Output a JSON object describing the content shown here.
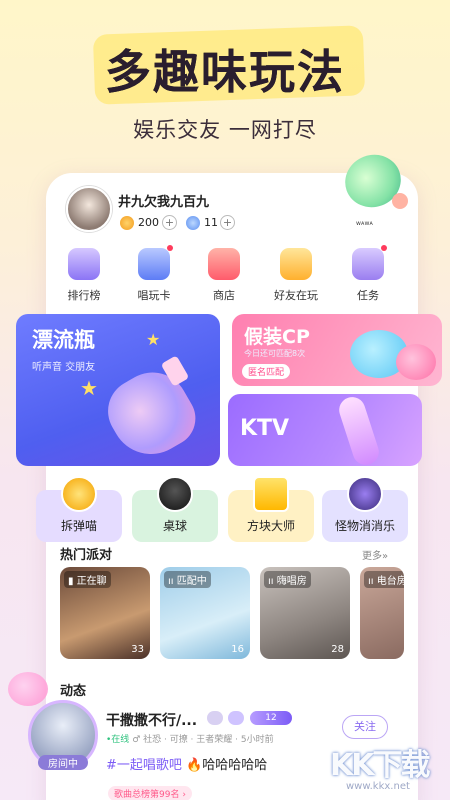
{
  "hero": {
    "title": "多趣味玩法",
    "subtitle": "娱乐交友 一网打尽"
  },
  "profile": {
    "name": "井九欠我九百九",
    "coins": "200",
    "gems": "11",
    "plus": "+",
    "tag": "ᴡᴀᴡᴀ"
  },
  "nav": [
    {
      "label": "排行榜",
      "icon": "trophy-icon",
      "dot": false
    },
    {
      "label": "唱玩卡",
      "icon": "card-icon",
      "dot": true
    },
    {
      "label": "商店",
      "icon": "gift-shop-icon",
      "dot": false
    },
    {
      "label": "好友在玩",
      "icon": "friends-icon",
      "dot": false
    },
    {
      "label": "任务",
      "icon": "task-icon",
      "dot": true
    }
  ],
  "cards": {
    "drift": {
      "title": "漂流瓶",
      "sub": "听声音 交朋友"
    },
    "cp": {
      "title": "假装CP",
      "sub": "今日还可匹配8次",
      "badge": "匿名匹配"
    },
    "ktv": {
      "title": "KTV"
    }
  },
  "games": [
    {
      "label": "拆弹喵",
      "bg": "#e5dcff"
    },
    {
      "label": "桌球",
      "bg": "#d9f3df"
    },
    {
      "label": "方块大师",
      "bg": "#fff1c4"
    },
    {
      "label": "怪物消消乐",
      "bg": "#e4e1ff"
    }
  ],
  "hot": {
    "title": "热门派对",
    "more": "更多»",
    "rooms": [
      {
        "tag": "▮ 正在聊",
        "count": "33"
      },
      {
        "tag": "ıı 匹配中",
        "count": "16"
      },
      {
        "tag": "ıı 嗨唱房",
        "count": "28"
      },
      {
        "tag": "ıı 电台房",
        "count": ""
      }
    ]
  },
  "feed": {
    "title": "动态",
    "avatar_tag": "房间中",
    "name": "干撒撒不行/...",
    "level": "12",
    "meta_online": "•在线",
    "meta_rest": "♂ 社恐 · 可撩 · 王者荣耀 · 5小时前",
    "follow": "关注",
    "hashtag": "#一起唱歌吧",
    "text": "🔥哈哈哈哈哈",
    "rank": "歌曲总榜第99名 ›"
  },
  "watermark": {
    "logo": "KK下载",
    "url": "www.kkx.net"
  }
}
